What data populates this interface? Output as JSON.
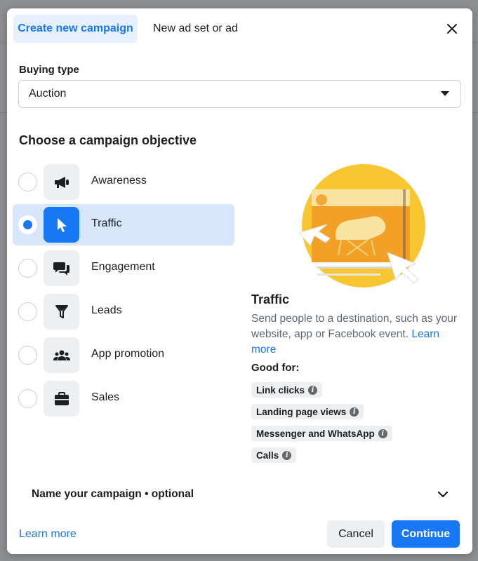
{
  "tabs": {
    "create_label": "Create new campaign",
    "new_label": "New ad set or ad"
  },
  "buying": {
    "label": "Buying type",
    "value": "Auction"
  },
  "objectives": {
    "heading": "Choose a campaign objective",
    "items": [
      {
        "label": "Awareness",
        "icon": "megaphone-icon",
        "selected": false
      },
      {
        "label": "Traffic",
        "icon": "cursor-icon",
        "selected": true
      },
      {
        "label": "Engagement",
        "icon": "chat-bubbles-icon",
        "selected": false
      },
      {
        "label": "Leads",
        "icon": "filter-icon",
        "selected": false
      },
      {
        "label": "App promotion",
        "icon": "people-icon",
        "selected": false
      },
      {
        "label": "Sales",
        "icon": "briefcase-icon",
        "selected": false
      }
    ]
  },
  "detail": {
    "title": "Traffic",
    "description": "Send people to a destination, such as your website, app or Facebook event.",
    "learn_more": "Learn more",
    "good_for_label": "Good for:",
    "chips": [
      "Link clicks",
      "Landing page views",
      "Messenger and WhatsApp",
      "Calls"
    ]
  },
  "name_section": {
    "label": "Name your campaign • optional"
  },
  "footer": {
    "learn_more": "Learn more",
    "cancel_label": "Cancel",
    "continue_label": "Continue"
  },
  "colors": {
    "accent": "#1877f2",
    "selected_bg": "#d8e6fb",
    "illustration_yellow": "#f7c631"
  }
}
